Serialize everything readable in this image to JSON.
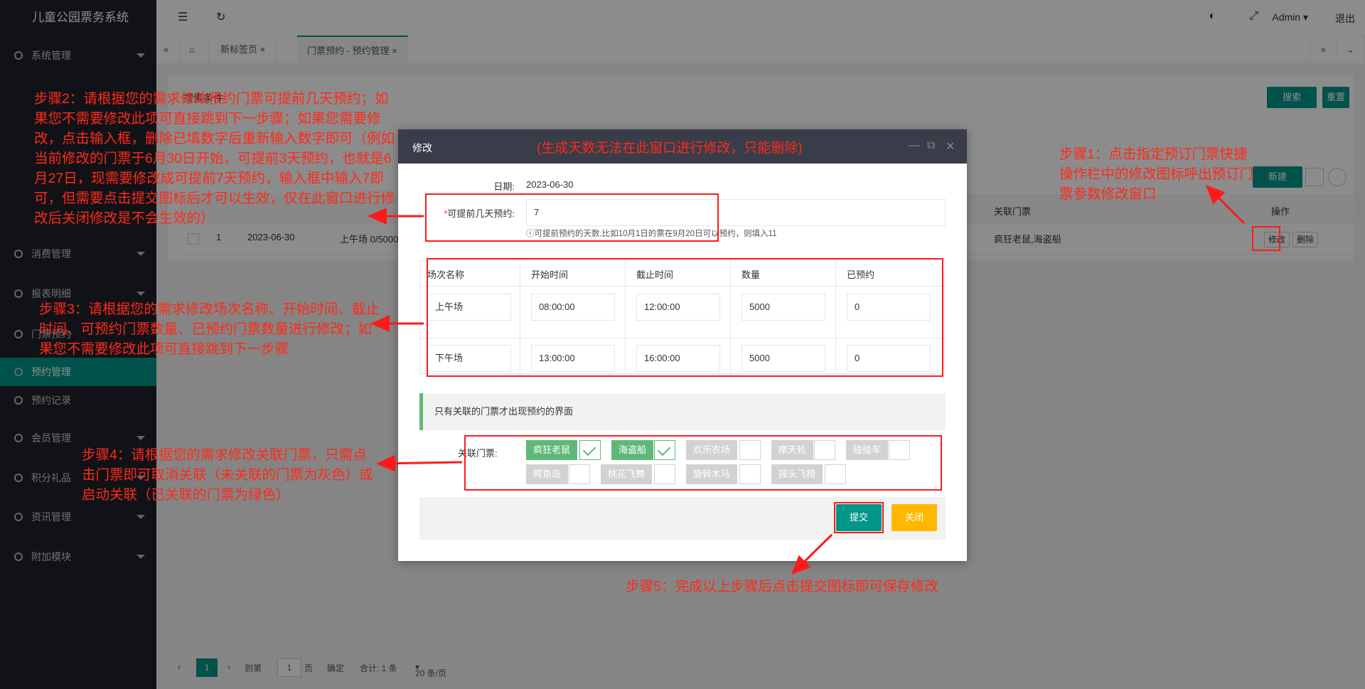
{
  "app": {
    "title": "儿童公园票务系统",
    "admin": "Admin",
    "logout": "退出"
  },
  "sidebar": {
    "items": [
      {
        "label": "系统管理"
      },
      {
        "label": "消费管理"
      },
      {
        "label": "报表明细"
      },
      {
        "label": "门票预约"
      },
      {
        "label": "预约管理"
      },
      {
        "label": "预约记录"
      },
      {
        "label": "会员管理"
      },
      {
        "label": "积分礼品"
      },
      {
        "label": "资讯管理"
      },
      {
        "label": "附加模块"
      }
    ]
  },
  "tabs": [
    {
      "label": "新标签页"
    },
    {
      "label": "门票预约 - 预约管理"
    }
  ],
  "page": {
    "search_title": "搜索条件",
    "search_btn": "搜索",
    "reset_btn": "重置",
    "new_btn": "新建",
    "col_ops": "操作",
    "col_linked": "关联门票",
    "row_index": "1",
    "row_date": "2023-06-30",
    "row_session": "上午场 0/5000",
    "row_linked": "疯狂老鼠,海盗船",
    "edit_btn": "修改",
    "delete_btn": "删除"
  },
  "pager": {
    "current": "1",
    "goto": "到第",
    "page_input": "1",
    "page_unit": "页",
    "confirm": "确定",
    "total": "合计: 1 条",
    "per_page": "20 条/页"
  },
  "modal": {
    "title": "修改",
    "note": "(生成天数无法在此窗口进行修改，只能删除)",
    "date_label": "日期:",
    "date_value": "2023-06-30",
    "advance_label": "可提前几天预约:",
    "advance_value": "7",
    "advance_hint": "ⓘ可提前预约的天数,比如10月1日的票在9月20日可以预约，则填入11",
    "table_headers": [
      "场次名称",
      "开始时间",
      "截止时间",
      "数量",
      "已预约"
    ],
    "rows": [
      {
        "name": "上午场",
        "start": "08:00:00",
        "end": "12:00:00",
        "qty": "5000",
        "booked": "0"
      },
      {
        "name": "下午场",
        "start": "13:00:00",
        "end": "16:00:00",
        "qty": "5000",
        "booked": "0"
      }
    ],
    "notice": "只有关联的门票才出现预约的界面",
    "linked_label": "关联门票:",
    "tickets": [
      {
        "name": "疯狂老鼠",
        "on": true
      },
      {
        "name": "海盗船",
        "on": true
      },
      {
        "name": "欢乐农场",
        "on": false
      },
      {
        "name": "摩天轮",
        "on": false
      },
      {
        "name": "碰碰车",
        "on": false
      },
      {
        "name": "鳄鱼岛",
        "on": false
      },
      {
        "name": "桃花飞舞",
        "on": false
      },
      {
        "name": "旋转木马",
        "on": false
      },
      {
        "name": "摇头飞椅",
        "on": false
      }
    ],
    "submit": "提交",
    "close": "关闭"
  },
  "annotations": {
    "step1": "步骤1：点击指定预订门票快捷操作栏中的修改图标呼出预订门票参数修改窗口",
    "step2": "步骤2：请根据您的需求修改预约门票可提前几天预约；如果您不需要修改此项可直接跳到下一步骤；如果您需要修改，点击输入框，删除已填数字后重新输入数字即可（例如当前修改的门票于6月30日开始，可提前3天预约，也就是6月27日，现需要修改成可提前7天预约，输入框中输入7即可，但需要点击提交图标后才可以生效，仅在此窗口进行修改后关闭修改是不会生效的）",
    "step3": "步骤3：请根据您的需求修改场次名称、开始时间、截止时间、可预约门票数量、已预约门票数量进行修改；如果您不需要修改此项可直接跳到下一步骤",
    "step4": "步骤4：请根据您的需求修改关联门票，只需点击门票即可取消关联（未关联的门票为灰色）或启动关联（已关联的门票为绿色）",
    "step5": "步骤5：完成以上步骤后点击提交图标即可保存修改"
  },
  "colors": {
    "primary": "#009688",
    "warning": "#ffb800",
    "linked": "#5fb878",
    "unlinked": "#d2d2d2",
    "annotation": "#ff2a1a",
    "sidebar": "#20222a"
  }
}
